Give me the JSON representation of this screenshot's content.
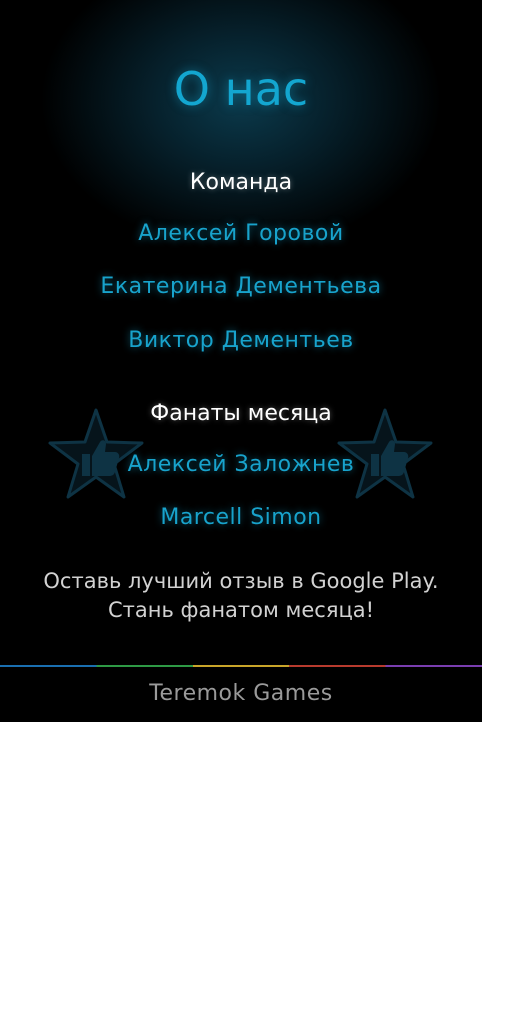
{
  "page": {
    "title": "О нас"
  },
  "team": {
    "heading": "Команда",
    "members": [
      "Алексей Горовой",
      "Екатерина Дементьева",
      "Виктор Дементьев"
    ]
  },
  "fans": {
    "heading": "Фанаты месяца",
    "members": [
      "Алексей Заложнев",
      "Marcell Simon"
    ]
  },
  "cta": {
    "line1": "Оставь лучший отзыв в Google Play.",
    "line2": "Стань фанатом месяца!"
  },
  "footer": {
    "brand": "Teremok Games"
  },
  "colors": {
    "accent": "#13a6d0",
    "heading": "#ffffff",
    "cta_text": "#d2d2d2",
    "brand_text": "#9a9a9a",
    "background": "#000000"
  },
  "icons": {
    "fans_decoration": "star-thumbs-up-icon"
  }
}
